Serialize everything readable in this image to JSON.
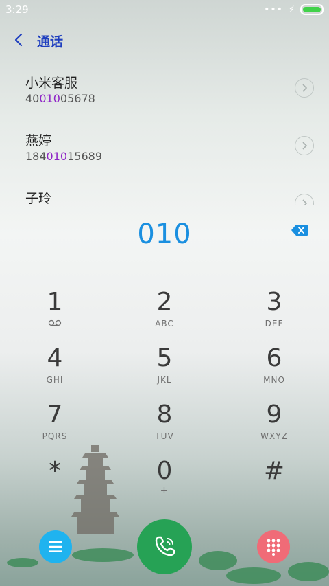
{
  "status": {
    "time": "3:29"
  },
  "header": {
    "title": "通话"
  },
  "contacts": [
    {
      "name": "小米客服",
      "number_pre": "40",
      "number_match": "010",
      "number_post": "05678"
    },
    {
      "name": "燕婷",
      "number_pre": "184",
      "number_match": "010",
      "number_post": "15689"
    },
    {
      "name": "子玲",
      "number_pre": "",
      "number_match": "",
      "number_post": ""
    }
  ],
  "dialer": {
    "input": "010",
    "keys": [
      {
        "digit": "1",
        "letters": ""
      },
      {
        "digit": "2",
        "letters": "ABC"
      },
      {
        "digit": "3",
        "letters": "DEF"
      },
      {
        "digit": "4",
        "letters": "GHI"
      },
      {
        "digit": "5",
        "letters": "JKL"
      },
      {
        "digit": "6",
        "letters": "MNO"
      },
      {
        "digit": "7",
        "letters": "PQRS"
      },
      {
        "digit": "8",
        "letters": "TUV"
      },
      {
        "digit": "9",
        "letters": "WXYZ"
      },
      {
        "digit": "*",
        "letters": ""
      },
      {
        "digit": "0",
        "letters": "+"
      },
      {
        "digit": "#",
        "letters": ""
      }
    ]
  },
  "colors": {
    "accent_blue": "#1a8fe0",
    "match_purple": "#8e24c6",
    "call_green": "#26a255",
    "menu_blue": "#1fb3ef",
    "keypad_pink": "#f06b77"
  },
  "icons": {
    "back": "chevron-left-icon",
    "voicemail": "voicemail-icon",
    "backspace": "backspace-icon",
    "menu": "menu-icon",
    "call": "phone-icon",
    "keypad": "dialpad-icon"
  }
}
